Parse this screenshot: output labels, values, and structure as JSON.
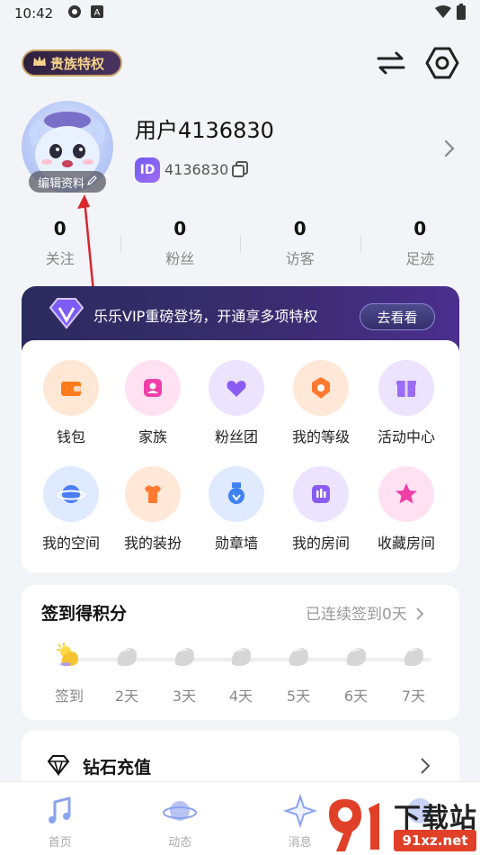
{
  "status_bar": {
    "time": "10:42",
    "icons": [
      "ring-icon",
      "a-icon"
    ],
    "right_icons": [
      "wifi-icon",
      "battery-icon"
    ]
  },
  "header": {
    "noble_badge": "贵族特权",
    "switch_icon": "switch-arrows-icon",
    "settings_icon": "hexagon-settings-icon"
  },
  "profile": {
    "username": "用户4136830",
    "id_badge": "ID",
    "id_value": "4136830",
    "edit_label": "编辑资料"
  },
  "stats": [
    {
      "value": "0",
      "label": "关注"
    },
    {
      "value": "0",
      "label": "粉丝"
    },
    {
      "value": "0",
      "label": "访客"
    },
    {
      "value": "0",
      "label": "足迹"
    }
  ],
  "vip": {
    "text": "乐乐VIP重磅登场，开通享多项特权",
    "button": "去看看"
  },
  "features": [
    {
      "label": "钱包",
      "icon": "wallet-icon",
      "bg": "#ffe7d6",
      "fg": "#ff7a1a"
    },
    {
      "label": "家族",
      "icon": "family-icon",
      "bg": "#ffe1f2",
      "fg": "#f03fa8"
    },
    {
      "label": "粉丝团",
      "icon": "heart-icon",
      "bg": "#ece3ff",
      "fg": "#8a5cf5"
    },
    {
      "label": "我的等级",
      "icon": "level-badge-icon",
      "bg": "#ffe8d8",
      "fg": "#ff7a30"
    },
    {
      "label": "活动中心",
      "icon": "gift-icon",
      "bg": "#ece3ff",
      "fg": "#9a6cf7"
    },
    {
      "label": "我的空间",
      "icon": "planet-icon",
      "bg": "#dfeaff",
      "fg": "#4a7df5"
    },
    {
      "label": "我的装扮",
      "icon": "shirt-icon",
      "bg": "#ffe8d8",
      "fg": "#ff7a30"
    },
    {
      "label": "勋章墙",
      "icon": "medal-icon",
      "bg": "#dfeaff",
      "fg": "#3f82f3"
    },
    {
      "label": "我的房间",
      "icon": "room-icon",
      "bg": "#ece3ff",
      "fg": "#8a5cf5"
    },
    {
      "label": "收藏房间",
      "icon": "star-icon",
      "bg": "#ffe1f2",
      "fg": "#f03fa8"
    }
  ],
  "signin": {
    "title": "签到得积分",
    "status": "已连续签到0天",
    "days": [
      "签到",
      "2天",
      "3天",
      "4天",
      "5天",
      "6天",
      "7天"
    ]
  },
  "diamond": {
    "title": "钻石充值"
  },
  "nav": [
    {
      "label": "首页",
      "icon": "music-note-icon"
    },
    {
      "label": "动态",
      "icon": "planet-icon"
    },
    {
      "label": "消息",
      "icon": "sparkle-icon"
    },
    {
      "label": "我的",
      "icon": "profile-icon"
    }
  ],
  "watermark": {
    "text": "下载站",
    "url": "91xz.net"
  }
}
